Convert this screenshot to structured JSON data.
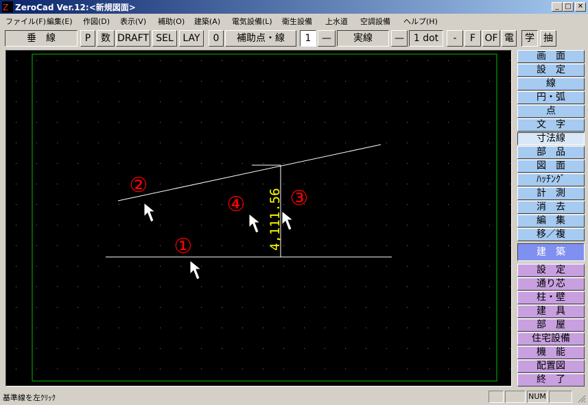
{
  "window": {
    "title": "ZeroCad Ver.12:<新規図面>",
    "minimize": "_",
    "maximize": "□",
    "close": "✕"
  },
  "menu": [
    "ファイル(F)",
    "編集(E)",
    "作図(D)",
    "表示(V)",
    "補助(O)",
    "建築(A)",
    "電気設備(L)",
    "衛生設備",
    "上水道",
    "空調設備",
    "ヘルプ(H)"
  ],
  "toolbar": {
    "mode": "垂　線",
    "p": "P",
    "num": "数",
    "draft": "DRAFT",
    "sel": "SEL",
    "lay": "LAY",
    "zero": "0",
    "aux": "補助点・線",
    "one": "1",
    "dash1": "—",
    "linetype": "実線",
    "dash2": "—",
    "dot": "1 dot",
    "minus": "-",
    "f": "F",
    "of": "OF",
    "den": "電",
    "gaku": "学",
    "chu": "抽"
  },
  "drawing": {
    "dimension_text": "4,111.56",
    "marker1": "①",
    "marker2": "②",
    "marker3": "③",
    "marker4": "④"
  },
  "sidebar": {
    "top": [
      "画　面",
      "設　定",
      "線",
      "円・弧",
      "点",
      "文　字",
      "寸法線",
      "部　品",
      "図　面",
      "ﾊｯﾁﾝｸﾞ",
      "計　測",
      "消　去",
      "編　集",
      "移／複"
    ],
    "active_index": 6,
    "header": "建　築",
    "bottom": [
      "設　定",
      "通り芯",
      "柱・壁",
      "建　具",
      "部　屋",
      "住宅設備",
      "機　能",
      "配置図",
      "終　了"
    ]
  },
  "status": {
    "message": "基準線を左ｸﾘｯｸ",
    "num": "NUM"
  },
  "colors": {
    "canvas": "#000000",
    "dimension": "#ffff00",
    "marker": "#ff0000",
    "border_line": "#00c000"
  }
}
